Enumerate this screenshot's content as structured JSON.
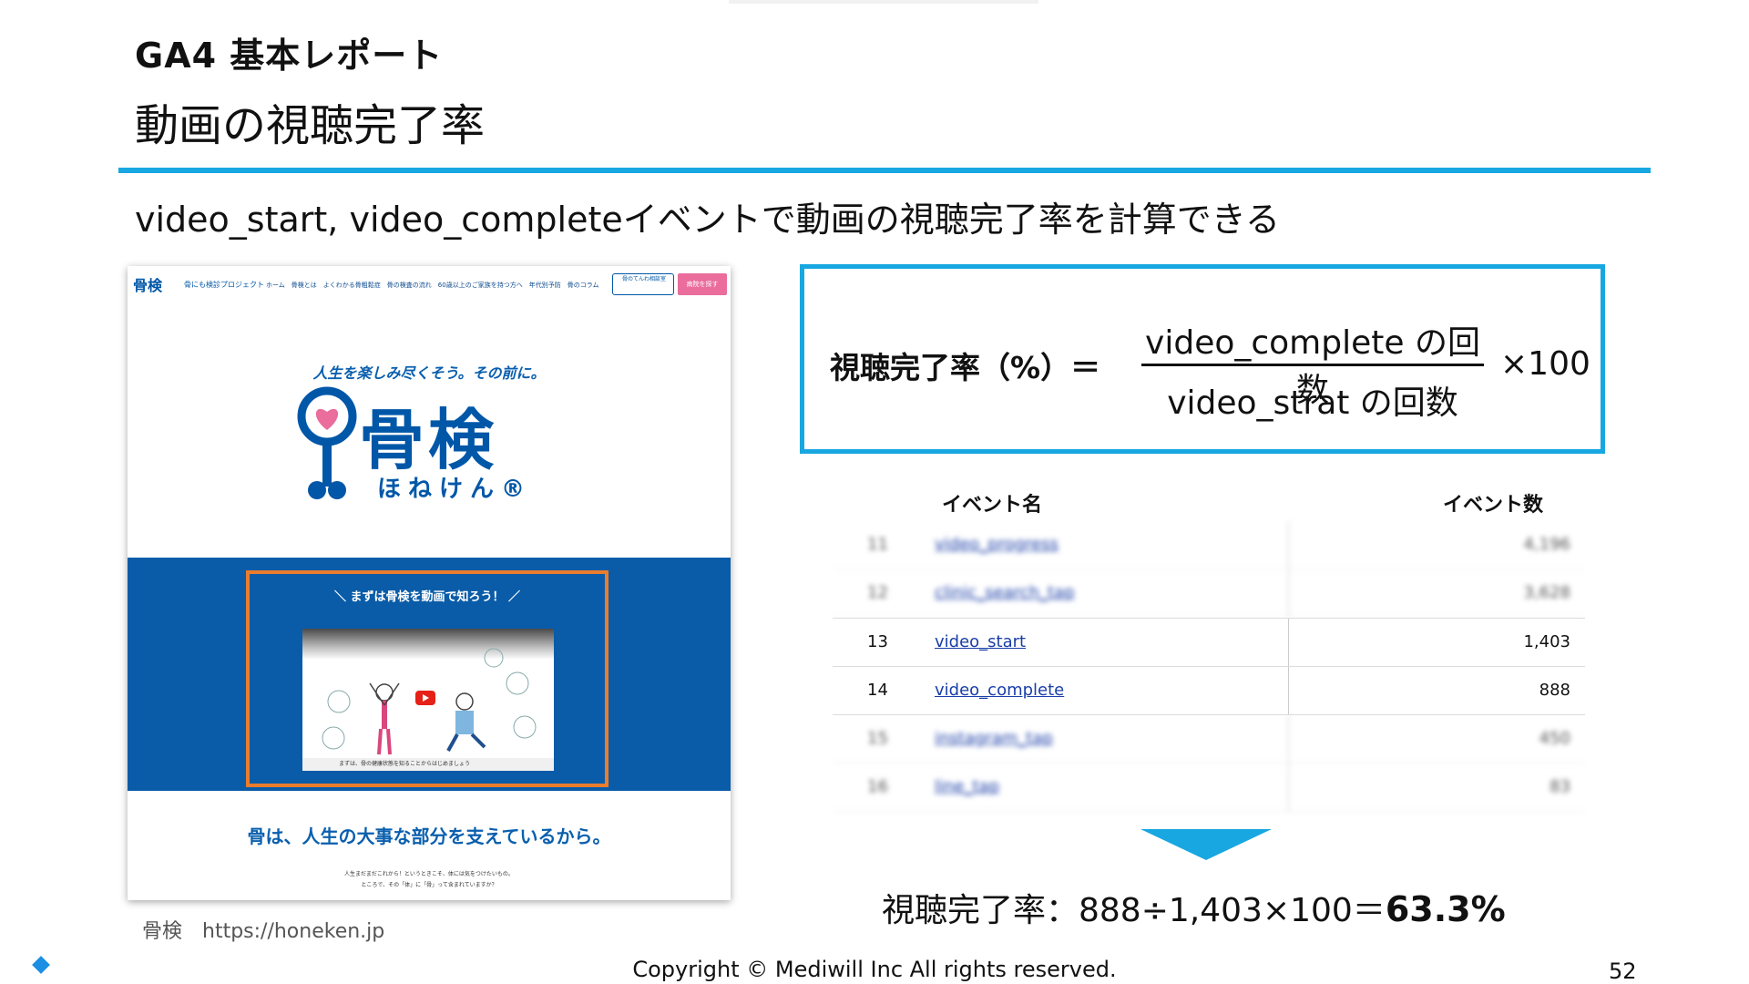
{
  "header": {
    "small_title": "GA4 基本レポート",
    "big_title": "動画の視聴完了率"
  },
  "lead": "video_start, video_completeイベントで動画の視聴完了率を計算できる",
  "site_screenshot": {
    "logo_small": "骨検",
    "logo_small_sub": "骨にも検診プロジェクト",
    "nav_items": "ホーム　骨検とは　よくわかる骨粗鬆症　骨の検査の流れ　60歳以上のご家族を持つ方へ　年代別予防　骨のコラム",
    "nav_box1": "骨のてんわ相談室",
    "nav_box2": "病院を探す",
    "tagline": "人生を楽しみ尽くそう。その前に。",
    "logo_main": "骨検",
    "logo_kana": "ほねけん®",
    "video_heading": "＼ まずは骨検を動画で知ろう！ ／",
    "video_caption": "まずは、骨の健康状態を知ることからはじめましょう",
    "bottom_title": "骨は、人生の大事な部分を支えているから。",
    "bottom_text_1": "人生まだまだこれから！というときこそ、体には気をつけたいもの。",
    "bottom_text_2": "ところで、その「体」に「骨」って含まれていますか？"
  },
  "source": "骨検　https://honeken.jp",
  "formula": {
    "label": "視聴完了率（%）＝",
    "numerator": "video_complete の回数",
    "denominator": "video_strat の回数",
    "multiplier": "×100"
  },
  "events_table": {
    "col_name": "イベント名",
    "col_count": "イベント数",
    "rows": [
      {
        "num": "11",
        "name": "video_progress",
        "count": "4,196"
      },
      {
        "num": "12",
        "name": "clinic_search_tap",
        "count": "3,628"
      },
      {
        "num": "13",
        "name": "video_start",
        "count": "1,403"
      },
      {
        "num": "14",
        "name": "video_complete",
        "count": "888"
      },
      {
        "num": "15",
        "name": "instagram_tap",
        "count": "450"
      },
      {
        "num": "16",
        "name": "line_tap",
        "count": "83"
      }
    ]
  },
  "result": {
    "prefix": "視聴完了率：888÷1,403×100＝",
    "value": "63.3%"
  },
  "footer": {
    "copyright": "Copyright © Mediwill Inc All rights reserved.",
    "page_number": "52"
  },
  "colors": {
    "accent": "#18a7e0",
    "site_blue": "#0a5ca8",
    "highlight_orange": "#ea7c2c"
  }
}
